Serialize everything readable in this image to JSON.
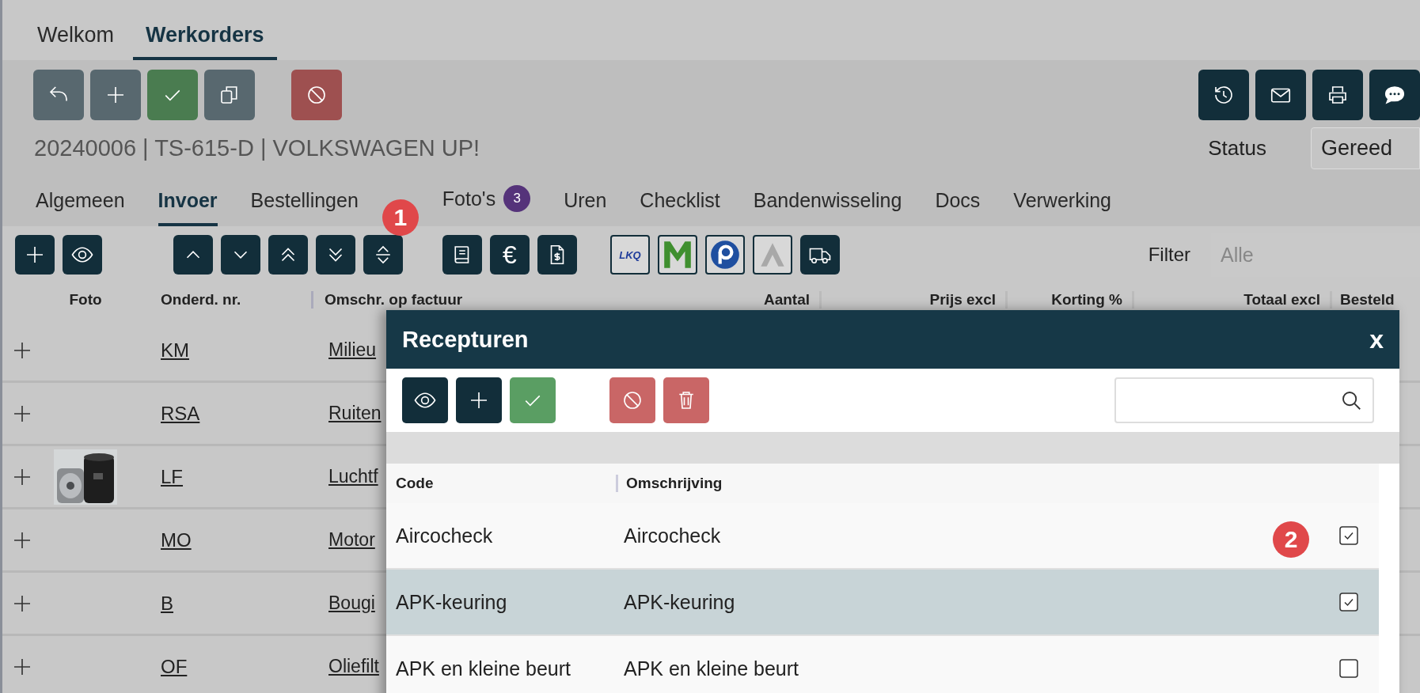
{
  "top_tabs": [
    {
      "label": "Welkom",
      "selected": false
    },
    {
      "label": "Werkorders",
      "selected": true
    }
  ],
  "work_order": {
    "title": "20240006 | TS-615-D | VOLKSWAGEN UP!",
    "status_label": "Status",
    "status_value": "Gereed"
  },
  "sub_tabs": [
    {
      "label": "Algemeen",
      "selected": false
    },
    {
      "label": "Invoer",
      "selected": true
    },
    {
      "label": "Bestellingen",
      "selected": false
    },
    {
      "label": "Foto's",
      "selected": false,
      "badge": "3"
    },
    {
      "label": "Uren",
      "selected": false
    },
    {
      "label": "Checklist",
      "selected": false
    },
    {
      "label": "Bandenwisseling",
      "selected": false
    },
    {
      "label": "Docs",
      "selected": false
    },
    {
      "label": "Verwerking",
      "selected": false
    }
  ],
  "toolbar": {
    "euro_symbol": "€",
    "supplier_logo_text": "LKQ",
    "filter_label": "Filter",
    "filter_placeholder": "Alle"
  },
  "table": {
    "columns": [
      "Foto",
      "Onderd. nr.",
      "Omschr. op factuur",
      "Aantal",
      "Prijs excl",
      "Korting %",
      "Totaal excl",
      "Besteld"
    ],
    "rows": [
      {
        "code": "KM",
        "description": "Milieu"
      },
      {
        "code": "RSA",
        "description": "Ruiten"
      },
      {
        "code": "LF",
        "description": "Luchtf"
      },
      {
        "code": "MO",
        "description": "Motor"
      },
      {
        "code": "B",
        "description": "Bougi"
      },
      {
        "code": "OF",
        "description": "Oliefilt"
      }
    ]
  },
  "dialog": {
    "title": "Recepturen",
    "close": "x",
    "columns": [
      "Code",
      "Omschrijving"
    ],
    "rows": [
      {
        "code": "Aircocheck",
        "description": "Aircocheck",
        "checked": true,
        "selected": false
      },
      {
        "code": "APK-keuring",
        "description": "APK-keuring",
        "checked": true,
        "selected": true
      },
      {
        "code": "APK en kleine beurt",
        "description": "APK en kleine beurt",
        "checked": false,
        "selected": false
      }
    ]
  },
  "markers": [
    "1",
    "2"
  ]
}
